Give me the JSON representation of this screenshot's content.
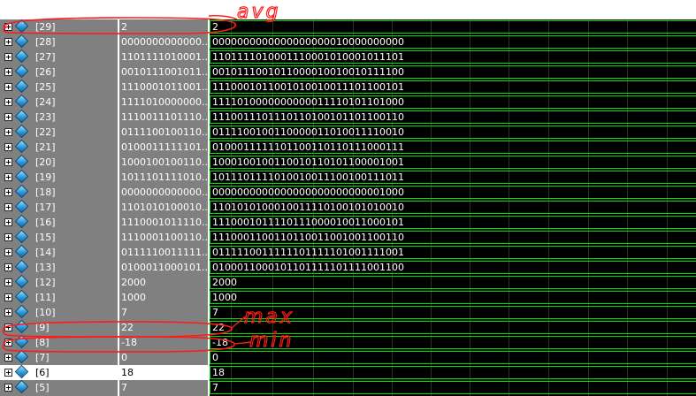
{
  "colors": {
    "names_bg": "#808080",
    "wave_bg": "#000000",
    "wave_trace": "#00e000",
    "annotation": "#ff1a1a"
  },
  "signals": [
    {
      "name": "[29]",
      "value": "2",
      "wave": "2",
      "selected": false
    },
    {
      "name": "[28]",
      "value": "0000000000000...",
      "wave": "0000000000000000000010000000000",
      "selected": false
    },
    {
      "name": "[27]",
      "value": "1101111010001...",
      "wave": "1101111010001110001010001011101",
      "selected": false
    },
    {
      "name": "[26]",
      "value": "0010111001011...",
      "wave": "0010111001011000010010010111100",
      "selected": false
    },
    {
      "name": "[25]",
      "value": "1110001011001...",
      "wave": "1110001011001010010011101100101",
      "selected": false
    },
    {
      "name": "[24]",
      "value": "1111010000000...",
      "wave": "1111010000000000011110101101000",
      "selected": false
    },
    {
      "name": "[23]",
      "value": "1110011101110...",
      "wave": "1110011101110110100101101100110",
      "selected": false
    },
    {
      "name": "[22]",
      "value": "0111100100110...",
      "wave": "0111100100110000011010011110010",
      "selected": false
    },
    {
      "name": "[21]",
      "value": "0100011111101...",
      "wave": "0100011111101100110110111000111",
      "selected": false
    },
    {
      "name": "[20]",
      "value": "1000100100110...",
      "wave": "1000100100110010110101100001001",
      "selected": false
    },
    {
      "name": "[19]",
      "value": "1011101111010...",
      "wave": "1011101111010010011100100111011",
      "selected": false
    },
    {
      "name": "[18]",
      "value": "0000000000000...",
      "wave": "0000000000000000000000000001000",
      "selected": false
    },
    {
      "name": "[17]",
      "value": "1101010100010...",
      "wave": "1101010100010011110100101010010",
      "selected": false
    },
    {
      "name": "[16]",
      "value": "1110001011110...",
      "wave": "1110001011110111000010011000101",
      "selected": false
    },
    {
      "name": "[15]",
      "value": "1110001100110...",
      "wave": "1110001100110110011001001100110",
      "selected": false
    },
    {
      "name": "[14]",
      "value": "0111110011111...",
      "wave": "0111110011111101111101001111001",
      "selected": false
    },
    {
      "name": "[13]",
      "value": "0100011000101...",
      "wave": "0100011000101101111101111001100",
      "selected": false
    },
    {
      "name": "[12]",
      "value": "2000",
      "wave": "2000",
      "selected": false
    },
    {
      "name": "[11]",
      "value": "1000",
      "wave": "1000",
      "selected": false
    },
    {
      "name": "[10]",
      "value": "7",
      "wave": "7",
      "selected": false
    },
    {
      "name": "[9]",
      "value": "22",
      "wave": "22",
      "selected": false
    },
    {
      "name": "[8]",
      "value": "-18",
      "wave": "-18",
      "selected": false
    },
    {
      "name": "[7]",
      "value": "0",
      "wave": "0",
      "selected": false
    },
    {
      "name": "[6]",
      "value": "18",
      "wave": "18",
      "selected": true
    },
    {
      "name": "[5]",
      "value": "7",
      "wave": "7",
      "selected": false
    }
  ],
  "annotations": {
    "avg": "avg",
    "max": "max",
    "min": "min"
  }
}
